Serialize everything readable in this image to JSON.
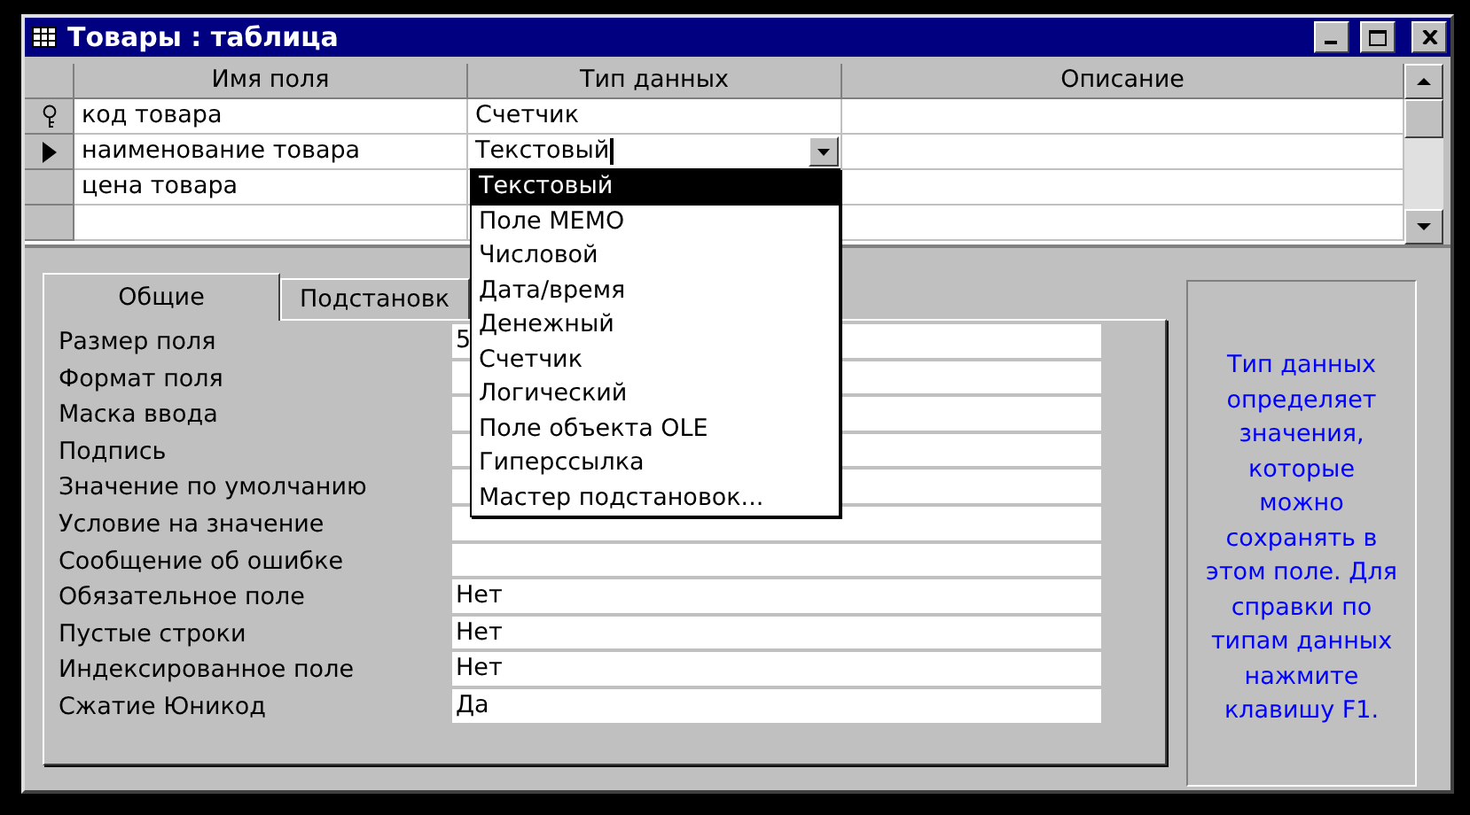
{
  "window": {
    "title": "Товары : таблица"
  },
  "grid": {
    "columns": [
      "Имя поля",
      "Тип данных",
      "Описание"
    ],
    "rows": [
      {
        "name": "код товара",
        "type": "Счетчик",
        "primary_key": true,
        "selected": false
      },
      {
        "name": "наименование товара",
        "type": "Текстовый",
        "primary_key": false,
        "selected": true
      },
      {
        "name": "цена товара",
        "primary_key": false,
        "selected": false
      }
    ]
  },
  "type_dropdown": {
    "items": [
      {
        "label": "Текстовый",
        "selected": true
      },
      {
        "label": "Поле MEMO",
        "selected": false
      },
      {
        "label": "Числовой",
        "selected": false
      },
      {
        "label": "Дата/время",
        "selected": false
      },
      {
        "label": "Денежный",
        "selected": false
      },
      {
        "label": "Счетчик",
        "selected": false
      },
      {
        "label": "Логический",
        "selected": false
      },
      {
        "label": "Поле объекта OLE",
        "selected": false
      },
      {
        "label": "Гиперссылка",
        "selected": false
      },
      {
        "label": "Мастер подстановок...",
        "selected": false
      }
    ]
  },
  "tabs": [
    {
      "label": "Общие",
      "selected": true
    },
    {
      "label": "Подстановк",
      "selected": false
    }
  ],
  "properties": [
    {
      "label": "Размер поля",
      "value": "5"
    },
    {
      "label": "Формат поля"
    },
    {
      "label": "Маска ввода"
    },
    {
      "label": "Подпись"
    },
    {
      "label": "Значение по умолчанию"
    },
    {
      "label": "Условие на значение"
    },
    {
      "label": "Сообщение об ошибке"
    },
    {
      "label": "Обязательное поле",
      "value": "Нет"
    },
    {
      "label": "Пустые строки",
      "value": "Нет"
    },
    {
      "label": "Индексированное поле",
      "value": "Нет"
    },
    {
      "label": "Сжатие Юникод",
      "value": "Да"
    }
  ],
  "help_text": "Тип данных определяет значения, которые можно сохранять в этом поле. Для справки по типам данных нажмите клавишу F1."
}
